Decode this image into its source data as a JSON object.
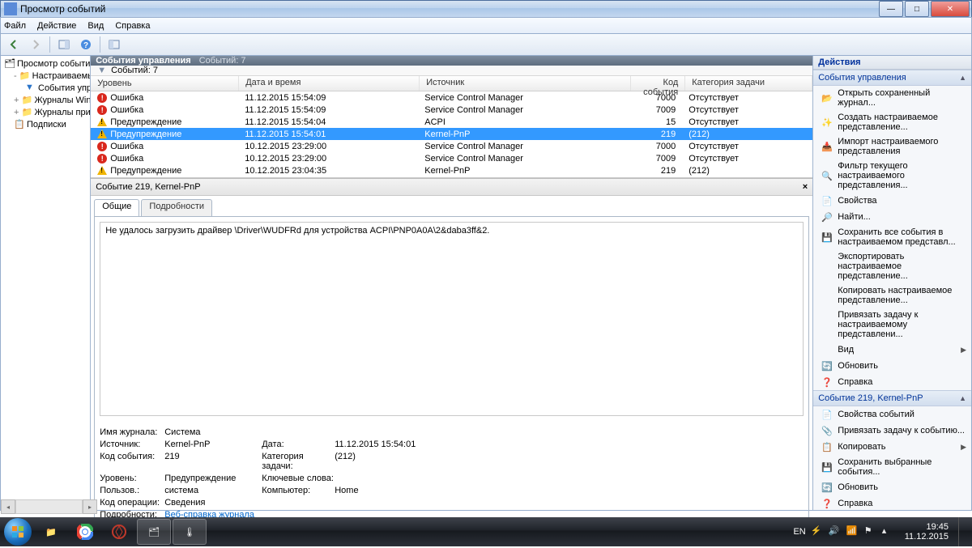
{
  "window": {
    "title": "Просмотр событий"
  },
  "menu": {
    "file": "Файл",
    "action": "Действие",
    "view": "Вид",
    "help": "Справка"
  },
  "tree": {
    "root": "Просмотр событий (Локальны",
    "custom": "Настраиваемые представл",
    "adminEvents": "События управления",
    "winLogs": "Журналы Windows",
    "appLogs": "Журналы приложений и сл",
    "subs": "Подписки"
  },
  "centerHeader": {
    "title": "События управления",
    "count": "Событий: 7"
  },
  "filterRow": {
    "label": "Событий: 7"
  },
  "cols": {
    "level": "Уровень",
    "date": "Дата и время",
    "src": "Источник",
    "id": "Код события",
    "cat": "Категория задачи"
  },
  "levels": {
    "error": "Ошибка",
    "warning": "Предупреждение"
  },
  "events": [
    {
      "type": "error",
      "date": "11.12.2015 15:54:09",
      "src": "Service Control Manager",
      "id": "7000",
      "cat": "Отсутствует"
    },
    {
      "type": "error",
      "date": "11.12.2015 15:54:09",
      "src": "Service Control Manager",
      "id": "7009",
      "cat": "Отсутствует"
    },
    {
      "type": "warning",
      "date": "11.12.2015 15:54:04",
      "src": "ACPI",
      "id": "15",
      "cat": "Отсутствует"
    },
    {
      "type": "warning",
      "date": "11.12.2015 15:54:01",
      "src": "Kernel-PnP",
      "id": "219",
      "cat": "(212)",
      "selected": true
    },
    {
      "type": "error",
      "date": "10.12.2015 23:29:00",
      "src": "Service Control Manager",
      "id": "7000",
      "cat": "Отсутствует"
    },
    {
      "type": "error",
      "date": "10.12.2015 23:29:00",
      "src": "Service Control Manager",
      "id": "7009",
      "cat": "Отсутствует"
    },
    {
      "type": "warning",
      "date": "10.12.2015 23:04:35",
      "src": "Kernel-PnP",
      "id": "219",
      "cat": "(212)"
    }
  ],
  "detail": {
    "title": "Событие 219, Kernel-PnP",
    "tabGeneral": "Общие",
    "tabDetails": "Подробности",
    "message": "Не удалось загрузить драйвер \\Driver\\WUDFRd для устройства ACPI\\PNP0A0A\\2&daba3ff&2.",
    "labels": {
      "logName": "Имя журнала:",
      "source": "Источник:",
      "eventId": "Код события:",
      "level": "Уровень:",
      "user": "Пользов.:",
      "opcode": "Код операции:",
      "moreInfo": "Подробности:",
      "date": "Дата:",
      "category": "Категория задачи:",
      "keywords": "Ключевые слова:",
      "computer": "Компьютер:"
    },
    "values": {
      "logName": "Система",
      "source": "Kernel-PnP",
      "eventId": "219",
      "level": "Предупреждение",
      "user": "система",
      "opcode": "Сведения",
      "moreInfo": "Веб-справка журнала ",
      "date": "11.12.2015 15:54:01",
      "category": "(212)",
      "keywords": "",
      "computer": "Home"
    }
  },
  "actions": {
    "paneTitle": "Действия",
    "cat1": "События управления",
    "items1": [
      "Открыть сохраненный журнал...",
      "Создать настраиваемое представление...",
      "Импорт настраиваемого представления",
      "Фильтр текущего настраиваемого представления...",
      "Свойства",
      "Найти...",
      "Сохранить все события в настраиваемом представл...",
      "Экспортировать настраиваемое представление...",
      "Копировать настраиваемое представление...",
      "Привязать задачу к настраиваемому представлени...",
      "Вид",
      "Обновить",
      "Справка"
    ],
    "cat2": "Событие 219, Kernel-PnP",
    "items2": [
      "Свойства событий",
      "Привязать задачу к событию...",
      "Копировать",
      "Сохранить выбранные события...",
      "Обновить",
      "Справка"
    ]
  },
  "taskbar": {
    "lang": "EN",
    "time": "19:45",
    "date": "11.12.2015"
  }
}
